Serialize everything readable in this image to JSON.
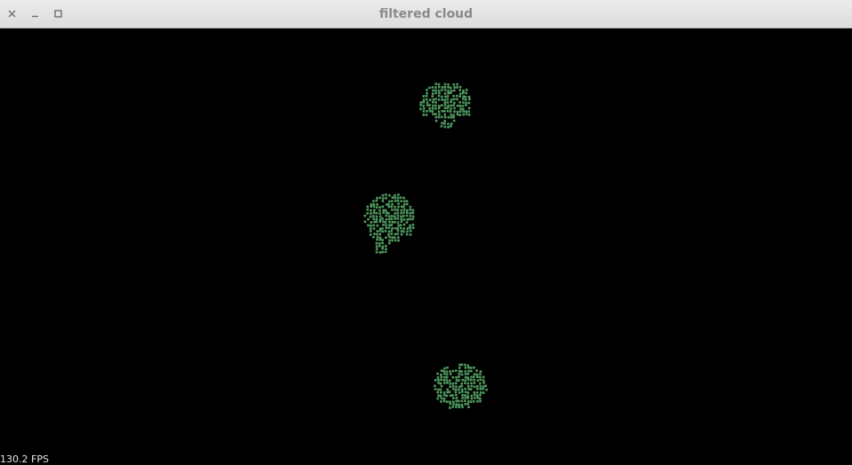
{
  "window": {
    "title": "filtered cloud"
  },
  "controls": {
    "close_icon": "close-icon",
    "minimize_icon": "minimize-icon",
    "maximize_icon": "maximize-icon"
  },
  "viewport": {
    "background_color": "#000000",
    "point_color": "#4f9a5e",
    "clusters": [
      "point-cluster-top",
      "point-cluster-middle",
      "point-cluster-bottom"
    ]
  },
  "status": {
    "fps_text": "130.2 FPS"
  }
}
